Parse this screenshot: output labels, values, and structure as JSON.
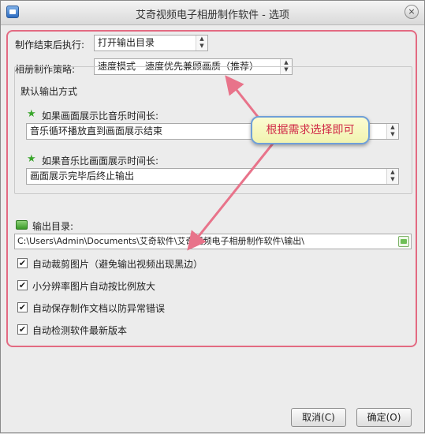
{
  "window": {
    "title": "艾奇视频电子相册制作软件 - 选项",
    "close_glyph": "×"
  },
  "settings": {
    "after_finish_label": "制作结束后执行:",
    "after_finish_value": "打开输出目录",
    "strategy_label": "相册制作策略:",
    "strategy_value": "速度模式 - 速度优先兼顾画质（推荐）"
  },
  "default_output": {
    "group_title": "默认输出方式",
    "case1_label": "如果画面展示比音乐时间长:",
    "case1_value": "音乐循环播放直到画面展示结束",
    "case2_label": "如果音乐比画面展示时间长:",
    "case2_value": "画面展示完毕后终止输出"
  },
  "output_dir": {
    "label": "输出目录:",
    "path": "C:\\Users\\Admin\\Documents\\艾奇软件\\艾奇视频电子相册制作软件\\输出\\"
  },
  "checkboxes": [
    {
      "label": "自动裁剪图片（避免输出视频出现黑边）",
      "checked": true
    },
    {
      "label": "小分辨率图片自动按比例放大",
      "checked": true
    },
    {
      "label": "自动保存制作文档以防异常错误",
      "checked": true
    },
    {
      "label": "自动检测软件最新版本",
      "checked": true
    }
  ],
  "check_glyph": "✔",
  "buttons": {
    "cancel": "取消(C)",
    "ok": "确定(O)"
  },
  "annotation": {
    "callout_text": "根据需求选择即可",
    "frame_color": "#e36a82"
  },
  "icons": {
    "star": "★",
    "arrow": "▲▼"
  }
}
